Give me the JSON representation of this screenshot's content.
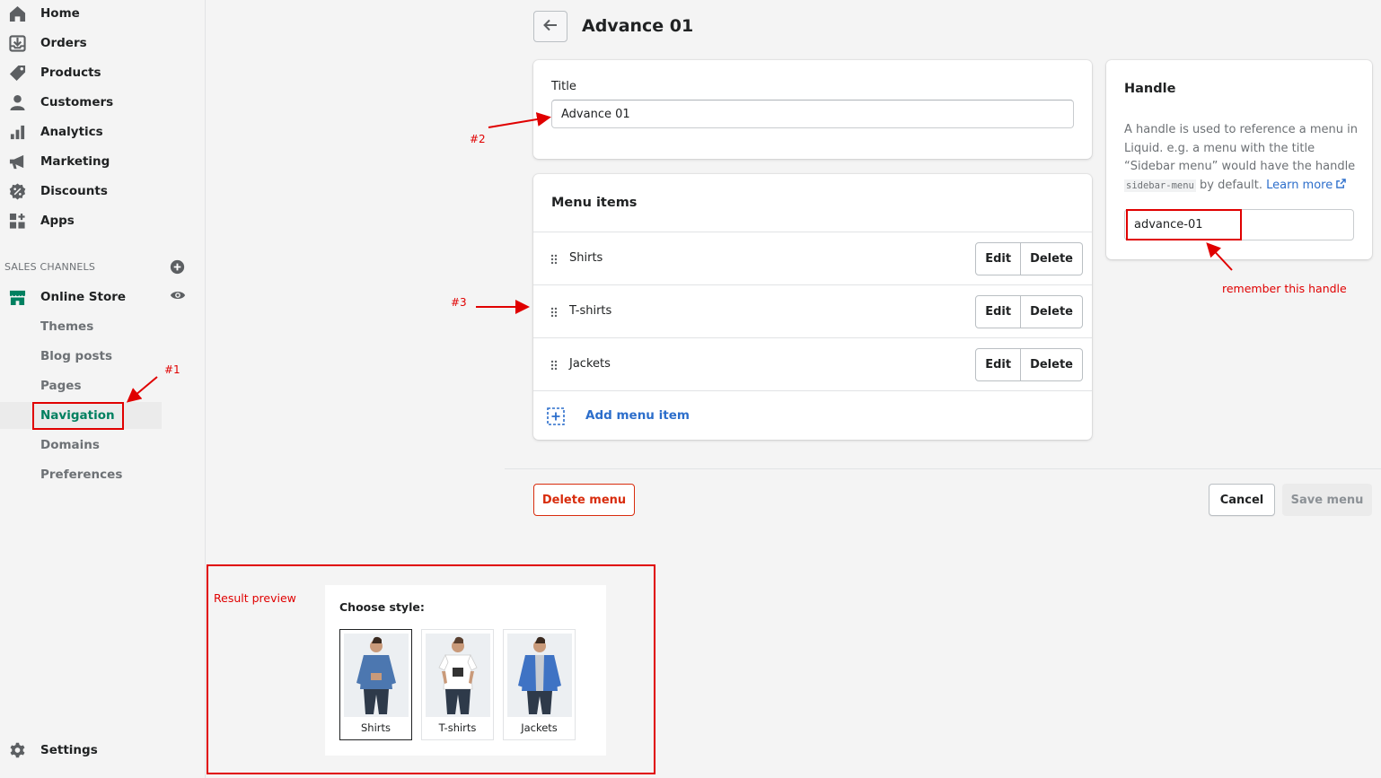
{
  "sidebar": {
    "items": [
      {
        "label": "Home",
        "icon": "home-icon"
      },
      {
        "label": "Orders",
        "icon": "orders-icon"
      },
      {
        "label": "Products",
        "icon": "products-tag-icon"
      },
      {
        "label": "Customers",
        "icon": "customers-icon"
      },
      {
        "label": "Analytics",
        "icon": "analytics-bars-icon"
      },
      {
        "label": "Marketing",
        "icon": "marketing-megaphone-icon"
      },
      {
        "label": "Discounts",
        "icon": "discounts-icon"
      },
      {
        "label": "Apps",
        "icon": "apps-grid-icon"
      }
    ],
    "sales_channels_label": "SALES CHANNELS",
    "online_store": {
      "label": "Online Store",
      "icon": "store-icon"
    },
    "sub_items": [
      "Themes",
      "Blog posts",
      "Pages",
      "Navigation",
      "Domains",
      "Preferences"
    ],
    "active_sub_item": "Navigation",
    "settings": {
      "label": "Settings",
      "icon": "gear-icon"
    }
  },
  "header": {
    "title": "Advance 01"
  },
  "title_card": {
    "label": "Title",
    "value": "Advance 01"
  },
  "menu_card": {
    "title": "Menu items",
    "items": [
      {
        "name": "Shirts"
      },
      {
        "name": "T-shirts"
      },
      {
        "name": "Jackets"
      }
    ],
    "edit_label": "Edit",
    "delete_label": "Delete",
    "add_label": "Add menu item"
  },
  "handle_card": {
    "title": "Handle",
    "desc_part1": "A handle is used to reference a menu in Liquid. e.g. a menu with the title “Sidebar menu” would have the handle",
    "desc_code": "sidebar-menu",
    "desc_part2": "by default.",
    "learn_more": "Learn more",
    "value": "advance-01"
  },
  "footer": {
    "delete_menu": "Delete menu",
    "cancel": "Cancel",
    "save": "Save menu"
  },
  "annotations": {
    "step1": "#1",
    "step2": "#2",
    "step3": "#3",
    "remember": "remember this handle",
    "result_preview": "Result preview"
  },
  "preview": {
    "choose_label": "Choose style:",
    "options": [
      {
        "label": "Shirts",
        "selected": true
      },
      {
        "label": "T-shirts",
        "selected": false
      },
      {
        "label": "Jackets",
        "selected": false
      }
    ]
  },
  "colors": {
    "accent_green": "#008060",
    "link_blue": "#2c6ecb",
    "critical_red": "#d82c0d",
    "annotation_red": "#e00000"
  }
}
